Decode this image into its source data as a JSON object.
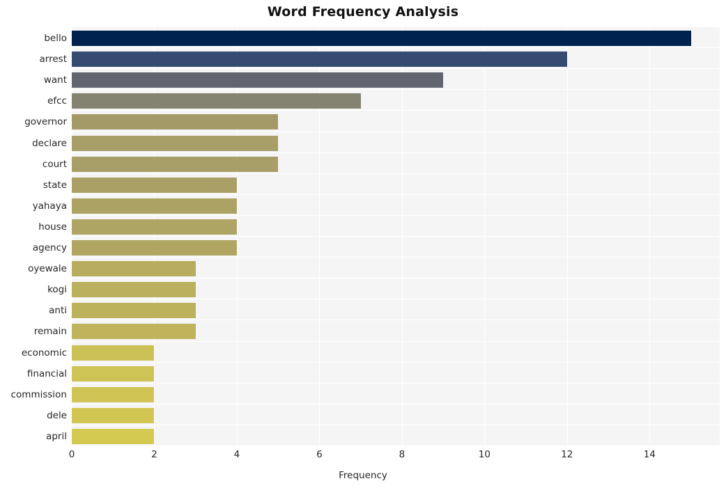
{
  "chart_data": {
    "type": "bar",
    "orientation": "horizontal",
    "title": "Word Frequency Analysis",
    "xlabel": "Frequency",
    "ylabel": "",
    "categories": [
      "bello",
      "arrest",
      "want",
      "efcc",
      "governor",
      "declare",
      "court",
      "state",
      "yahaya",
      "house",
      "agency",
      "oyewale",
      "kogi",
      "anti",
      "remain",
      "economic",
      "financial",
      "commission",
      "dele",
      "april"
    ],
    "values": [
      15,
      12,
      9,
      7,
      5,
      5,
      5,
      4,
      4,
      4,
      4,
      3,
      3,
      3,
      3,
      2,
      2,
      2,
      2,
      2
    ],
    "xlim": [
      0,
      15.7
    ],
    "xticks": [
      0,
      2,
      4,
      6,
      8,
      10,
      12,
      14
    ],
    "xtick_labels": [
      "0",
      "2",
      "4",
      "6",
      "8",
      "10",
      "12",
      "14"
    ],
    "grid": true,
    "grid_color": "#ffffff",
    "plot_background": "#f5f5f5",
    "figure_background": "#ffffff",
    "legend": null,
    "colormap": "cividis",
    "bar_colors": [
      "#00224e",
      "#364b71",
      "#62656f",
      "#848371",
      "#a49a68",
      "#a89e67",
      "#a89e67",
      "#aaa066",
      "#aca264",
      "#aea463",
      "#b0a662",
      "#b8ad5e",
      "#bbb05d",
      "#bdb25c",
      "#bfb45b",
      "#ccc157",
      "#cec355",
      "#d0c554",
      "#d2c753",
      "#d4c951"
    ]
  },
  "axis": {
    "title_text": "Word Frequency Analysis",
    "x_axis_title": "Frequency"
  }
}
